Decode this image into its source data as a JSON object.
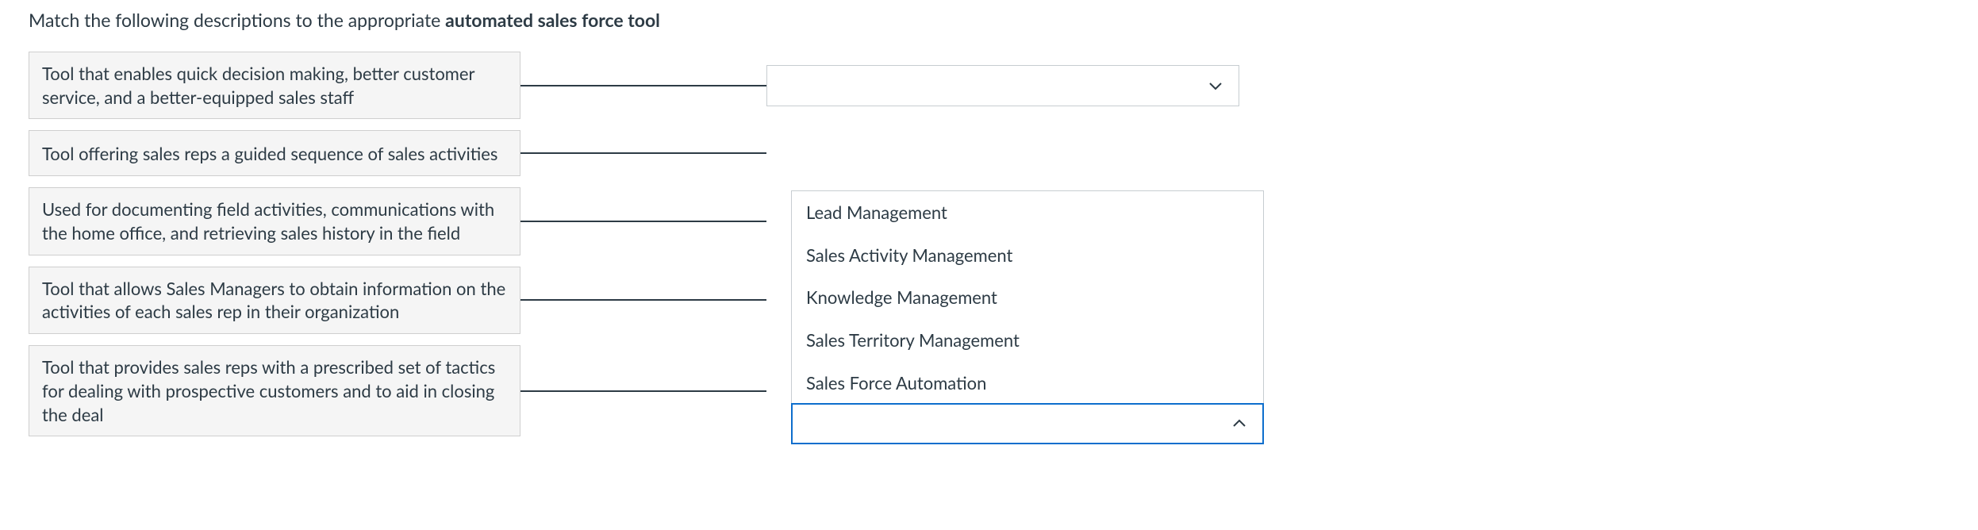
{
  "prompt": {
    "prefix": "Match the following descriptions to the appropriate ",
    "bold": "automated sales force tool"
  },
  "rows": [
    {
      "desc": "Tool that enables quick decision making, better customer service, and a better-equipped sales staff"
    },
    {
      "desc": "Tool offering sales reps a guided sequence of sales activities"
    },
    {
      "desc": "Used for documenting field activities, communications with the home office, and retrieving sales history in the field"
    },
    {
      "desc": "Tool that allows Sales Managers to obtain information on the activities of each sales rep in their organization"
    },
    {
      "desc": "Tool that provides sales reps with a prescribed set of tactics for dealing with prospective customers and to aid in closing the deal"
    }
  ],
  "options": [
    "Lead Management",
    "Sales Activity Management",
    "Knowledge Management",
    "Sales Territory Management",
    "Sales Force Automation"
  ]
}
